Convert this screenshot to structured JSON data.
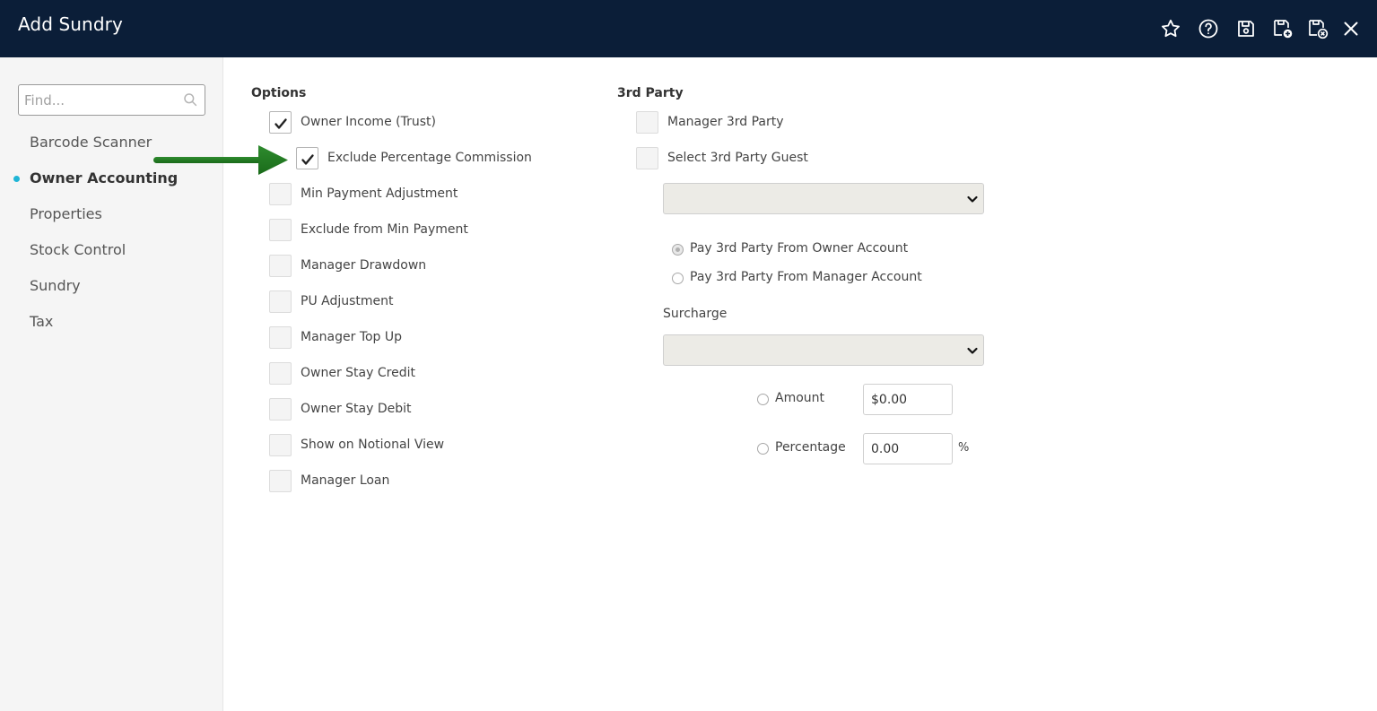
{
  "header": {
    "title": "Add Sundry",
    "icons": [
      "star-icon",
      "help-icon",
      "save-icon",
      "save-new-icon",
      "save-close-icon",
      "close-icon"
    ]
  },
  "sidebar": {
    "search_placeholder": "Find...",
    "items": [
      {
        "label": "Barcode Scanner",
        "active": false
      },
      {
        "label": "Owner Accounting",
        "active": true
      },
      {
        "label": "Properties",
        "active": false
      },
      {
        "label": "Stock Control",
        "active": false
      },
      {
        "label": "Sundry",
        "active": false
      },
      {
        "label": "Tax",
        "active": false
      }
    ]
  },
  "options": {
    "heading": "Options",
    "items": [
      {
        "label": "Owner Income (Trust)",
        "checked": true
      },
      {
        "label": "Exclude Percentage Commission",
        "checked": true
      },
      {
        "label": "Min Payment Adjustment",
        "checked": false
      },
      {
        "label": "Exclude from Min Payment",
        "checked": false
      },
      {
        "label": "Manager Drawdown",
        "checked": false
      },
      {
        "label": "PU Adjustment",
        "checked": false
      },
      {
        "label": "Manager Top Up",
        "checked": false
      },
      {
        "label": "Owner Stay Credit",
        "checked": false
      },
      {
        "label": "Owner Stay Debit",
        "checked": false
      },
      {
        "label": "Show on Notional View",
        "checked": false
      },
      {
        "label": "Manager Loan",
        "checked": false
      }
    ]
  },
  "third_party": {
    "heading": "3rd Party",
    "manager_3rd_party": {
      "label": "Manager 3rd Party",
      "checked": false
    },
    "select_3rd_party_guest": {
      "label": "Select 3rd Party Guest",
      "checked": false
    },
    "guest_select_value": "",
    "pay_from_owner": {
      "label": "Pay 3rd Party From Owner Account",
      "selected": true
    },
    "pay_from_manager": {
      "label": "Pay 3rd Party From Manager Account",
      "selected": false
    },
    "surcharge_label": "Surcharge",
    "surcharge_select_value": "",
    "amount": {
      "label": "Amount",
      "value": "$0.00",
      "selected": false
    },
    "percentage": {
      "label": "Percentage",
      "value": "0.00",
      "unit": "%",
      "selected": false
    }
  },
  "colors": {
    "header_bg": "#0b1e38",
    "sidebar_bg": "#f5f5f5",
    "active_dot": "#1fb5d6",
    "annotation_arrow": "#1f7a1f"
  }
}
